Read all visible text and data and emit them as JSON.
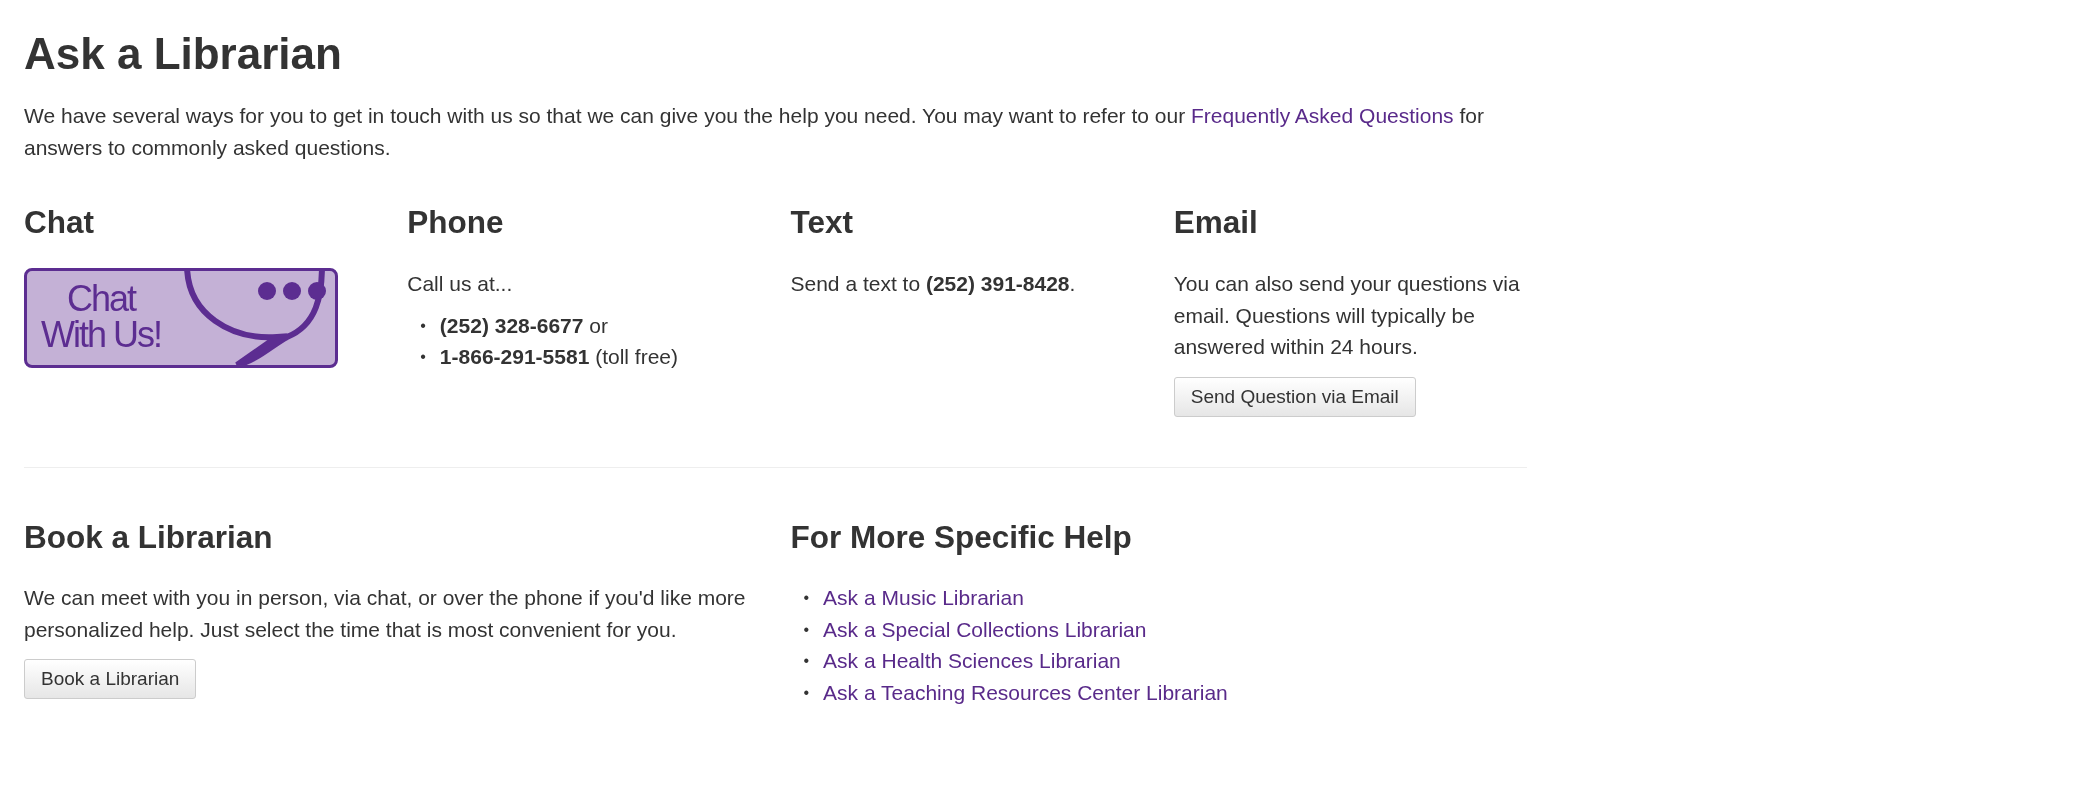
{
  "title": "Ask a Librarian",
  "intro": {
    "before": "We have several ways for you to get in touch with us so that we can give you the help you need. You may want to refer to our",
    "link": "Frequently Asked Questions",
    "after": "for answers to commonly asked questions."
  },
  "sections": [
    {
      "kind": "chat",
      "heading": "Chat",
      "badge": [
        "Chat",
        "With Us!"
      ]
    },
    {
      "kind": "phone",
      "heading": "Phone",
      "lead": "Call us at...",
      "bullet": "•",
      "numbers": [
        "**(252) 328-6677** or",
        "**1-866-291-5581** (toll free)"
      ]
    },
    {
      "kind": "text",
      "heading": "Text",
      "body": "Send a text to **(252) 391-8428**."
    },
    {
      "kind": "email",
      "heading": "Email",
      "body": "You can also send your questions via email. Questions will typically be answered within 24 hours.",
      "button": "Send Question via Email"
    }
  ],
  "book": {
    "heading": "Book a Librarian",
    "body": "We can meet with you in person, via chat, or over the phone if you'd like more personalized help. Just select the time that is most convenient for you.",
    "button": "Book a Librarian"
  },
  "specific": {
    "heading": "For More Specific Help",
    "bullet": "•",
    "links": [
      "Ask a Music Librarian",
      "Ask a Special Collections Librarian",
      "Ask a Health Sciences Librarian",
      "Ask a Teaching Resources Center Librarian"
    ]
  }
}
